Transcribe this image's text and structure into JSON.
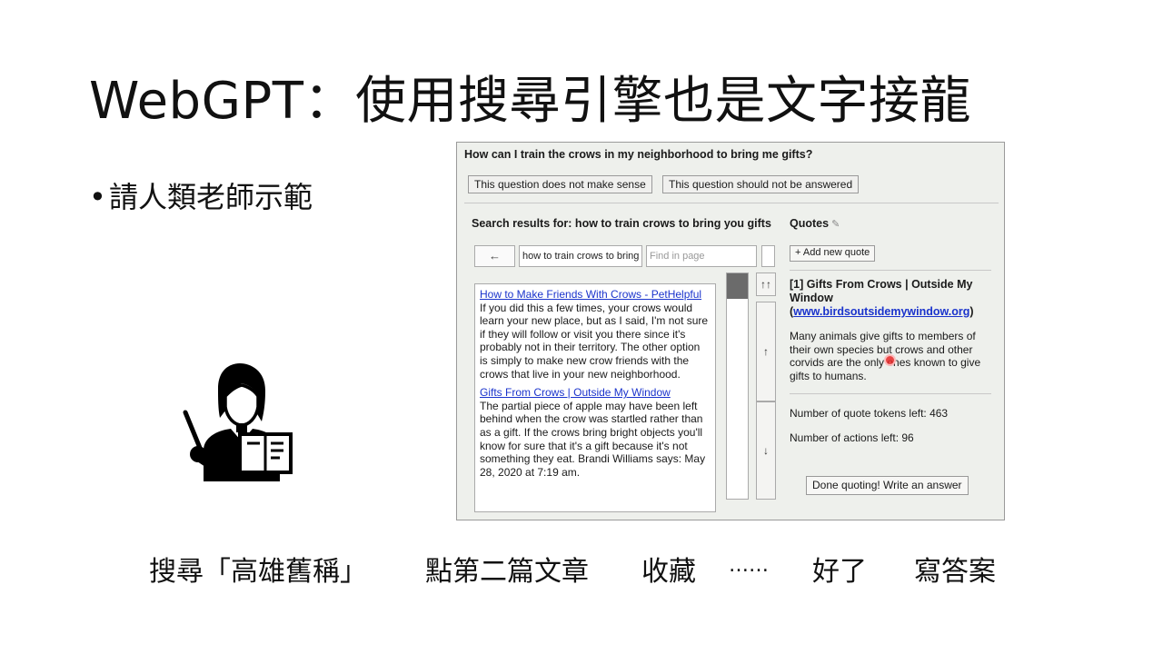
{
  "slide": {
    "title": "WebGPT：使用搜尋引擎也是文字接龍",
    "bullet": "請人類老師示範",
    "teacher_icon": "teacher-with-book-icon"
  },
  "steps": [
    "搜尋「高雄舊稱」",
    "點第二篇文章",
    "收藏",
    "……",
    "好了",
    "寫答案"
  ],
  "webgpt": {
    "question": "How can I train the crows in my neighborhood to bring me gifts?",
    "buttons": {
      "no_sense": "This question does not make sense",
      "no_answer": "This question should not be answered"
    },
    "search_heading": "Search results for: how to train crows to bring you gifts",
    "back_arrow": "←",
    "search_input_value": "how to train crows to bring",
    "find_placeholder": "Find in page",
    "results": [
      {
        "title": "How to Make Friends With Crows - PetHelpful",
        "snippet": "If you did this a few times, your crows would learn your new place, but as I said, I'm not sure if they will follow or visit you there since it's probably not in their territory. The other option is simply to make new crow friends with the crows that live in your new neighborhood."
      },
      {
        "title": "Gifts From Crows | Outside My Window",
        "snippet": "The partial piece of apple may have been left behind when the crow was startled rather than as a gift. If the crows bring bright objects you'll know for sure that it's a gift because it's not something they eat. Brandi Williams says: May 28, 2020 at 7:19 am."
      }
    ],
    "nav": {
      "top": "↑↑",
      "up": "↑",
      "down": "↓"
    },
    "quotes": {
      "heading": "Quotes",
      "edit_icon": "✎",
      "add_button": "+ Add new quote",
      "item_title": "[1] Gifts From Crows | Outside My Window",
      "item_url": "www.birdsoutsidemywindow.org",
      "item_text": "Many animals give gifts to members of their own species but crows and other corvids are the only ones known to give gifts to humans.",
      "tokens_left": "Number of quote tokens left: 463",
      "actions_left": "Number of actions left: 96",
      "done_button": "Done quoting! Write an answer"
    }
  }
}
